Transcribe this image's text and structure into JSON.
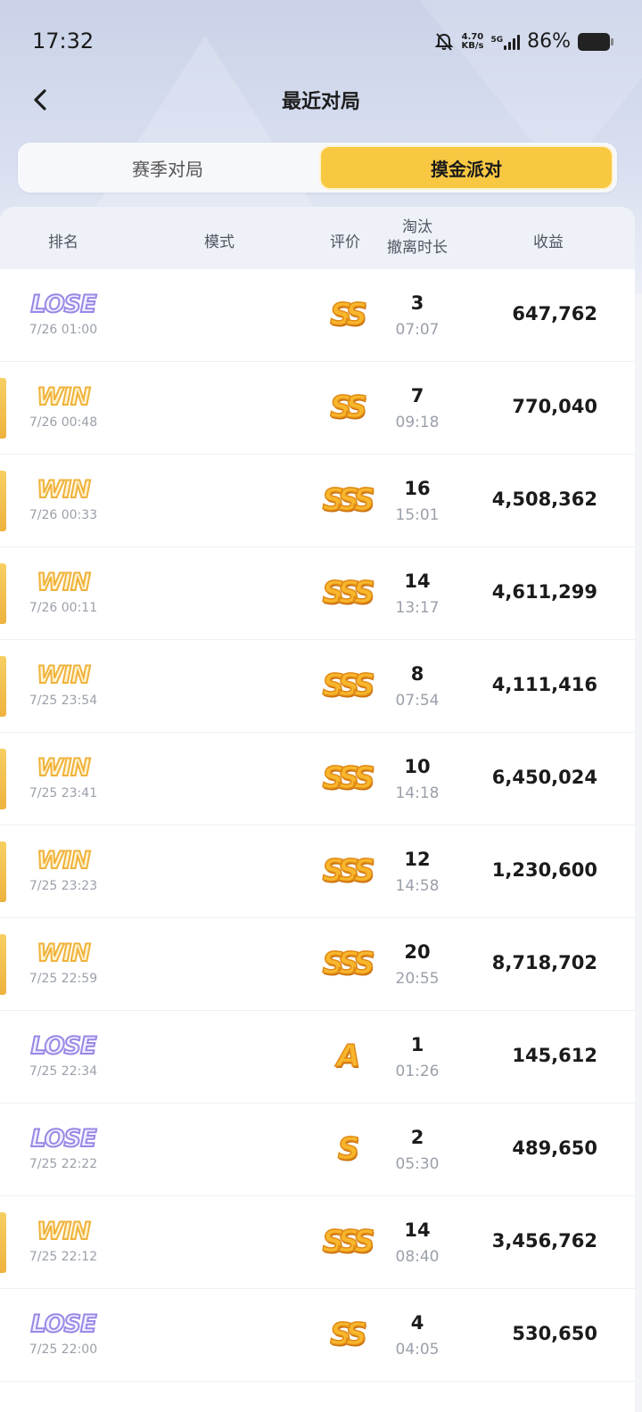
{
  "status_bar": {
    "time": "17:32",
    "net_speed_value": "4.70",
    "net_speed_unit": "KB/s",
    "net_type": "5G",
    "battery": "86%",
    "icons": [
      "bell-muted-icon",
      "signal-icon",
      "battery-icon"
    ]
  },
  "header": {
    "title": "最近对局",
    "back_icon": "chevron-left-icon"
  },
  "tabs": [
    {
      "label": "赛季对局",
      "active": false
    },
    {
      "label": "摸金派对",
      "active": true
    }
  ],
  "table": {
    "columns": {
      "rank": "排名",
      "mode": "模式",
      "rating": "评价",
      "kills_line1": "淘汰",
      "kills_line2": "撤离时长",
      "income": "收益"
    },
    "rows": [
      {
        "result": "LOSE",
        "date": "7/26 01:00",
        "rating": "SS",
        "kills": "3",
        "duration": "07:07",
        "income": "647,762"
      },
      {
        "result": "WIN",
        "date": "7/26 00:48",
        "rating": "SS",
        "kills": "7",
        "duration": "09:18",
        "income": "770,040"
      },
      {
        "result": "WIN",
        "date": "7/26 00:33",
        "rating": "SSS",
        "kills": "16",
        "duration": "15:01",
        "income": "4,508,362"
      },
      {
        "result": "WIN",
        "date": "7/26 00:11",
        "rating": "SSS",
        "kills": "14",
        "duration": "13:17",
        "income": "4,611,299"
      },
      {
        "result": "WIN",
        "date": "7/25 23:54",
        "rating": "SSS",
        "kills": "8",
        "duration": "07:54",
        "income": "4,111,416"
      },
      {
        "result": "WIN",
        "date": "7/25 23:41",
        "rating": "SSS",
        "kills": "10",
        "duration": "14:18",
        "income": "6,450,024"
      },
      {
        "result": "WIN",
        "date": "7/25 23:23",
        "rating": "SSS",
        "kills": "12",
        "duration": "14:58",
        "income": "1,230,600"
      },
      {
        "result": "WIN",
        "date": "7/25 22:59",
        "rating": "SSS",
        "kills": "20",
        "duration": "20:55",
        "income": "8,718,702"
      },
      {
        "result": "LOSE",
        "date": "7/25 22:34",
        "rating": "A",
        "kills": "1",
        "duration": "01:26",
        "income": "145,612"
      },
      {
        "result": "LOSE",
        "date": "7/25 22:22",
        "rating": "S",
        "kills": "2",
        "duration": "05:30",
        "income": "489,650"
      },
      {
        "result": "WIN",
        "date": "7/25 22:12",
        "rating": "SSS",
        "kills": "14",
        "duration": "08:40",
        "income": "3,456,762"
      },
      {
        "result": "LOSE",
        "date": "7/25 22:00",
        "rating": "SS",
        "kills": "4",
        "duration": "04:05",
        "income": "530,650"
      }
    ]
  },
  "colors": {
    "accent": "#f8c843",
    "win_bar": "#f0b23a",
    "lose_logo": "#9b86e6",
    "header_bg": "#eef1f8"
  }
}
